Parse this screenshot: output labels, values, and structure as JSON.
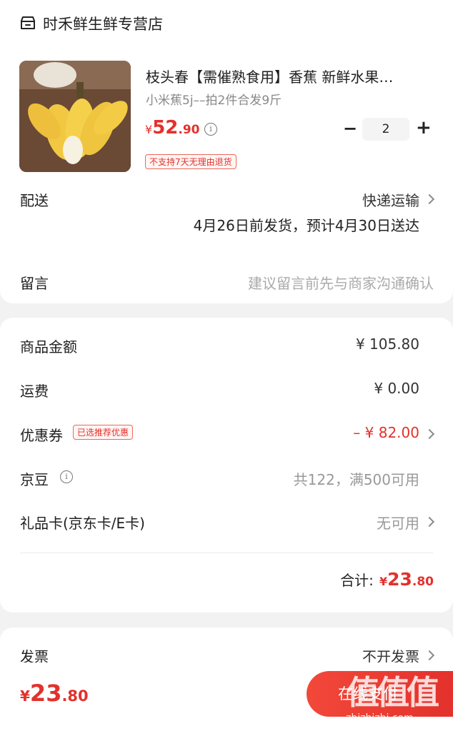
{
  "store": {
    "name": "时禾鲜生鲜专营店"
  },
  "product": {
    "title": "枝头春【需催熟食用】香蕉 新鲜水果…",
    "spec": "小米蕉5j––拍2件合发9斤",
    "price_symbol": "¥",
    "price_int": "52",
    "price_dec": ".90",
    "quantity": "2",
    "return_tag": "不支持7天无理由退货",
    "minus": "−",
    "plus": "+"
  },
  "delivery": {
    "label": "配送",
    "method": "快递运输",
    "eta": "4月26日前发货，预计4月30日送达"
  },
  "message": {
    "label": "留言",
    "placeholder": "建议留言前先与商家沟通确认"
  },
  "summary": {
    "goods_label": "商品金额",
    "goods_value": "¥ 105.80",
    "shipping_label": "运费",
    "shipping_value": "¥ 0.00",
    "coupon_label": "优惠券",
    "coupon_tag": "已选推荐优惠",
    "coupon_value": "– ¥ 82.00",
    "beans_label": "京豆",
    "beans_value": "共122，满500可用",
    "giftcard_label": "礼品卡(京东卡/E卡)",
    "giftcard_value": "无可用",
    "total_label": "合计:",
    "total_symbol": "¥",
    "total_int": "23",
    "total_dec": ".80"
  },
  "invoice": {
    "label": "发票",
    "value": "不开发票"
  },
  "footer": {
    "price_symbol": "¥",
    "price_int": "23",
    "price_dec": ".80",
    "pay_button": "在线支付",
    "watermark": "值值值",
    "watermark_url": "zhizhizhi.com"
  },
  "colors": {
    "accent": "#e3312c",
    "background": "#f2f2f2"
  }
}
